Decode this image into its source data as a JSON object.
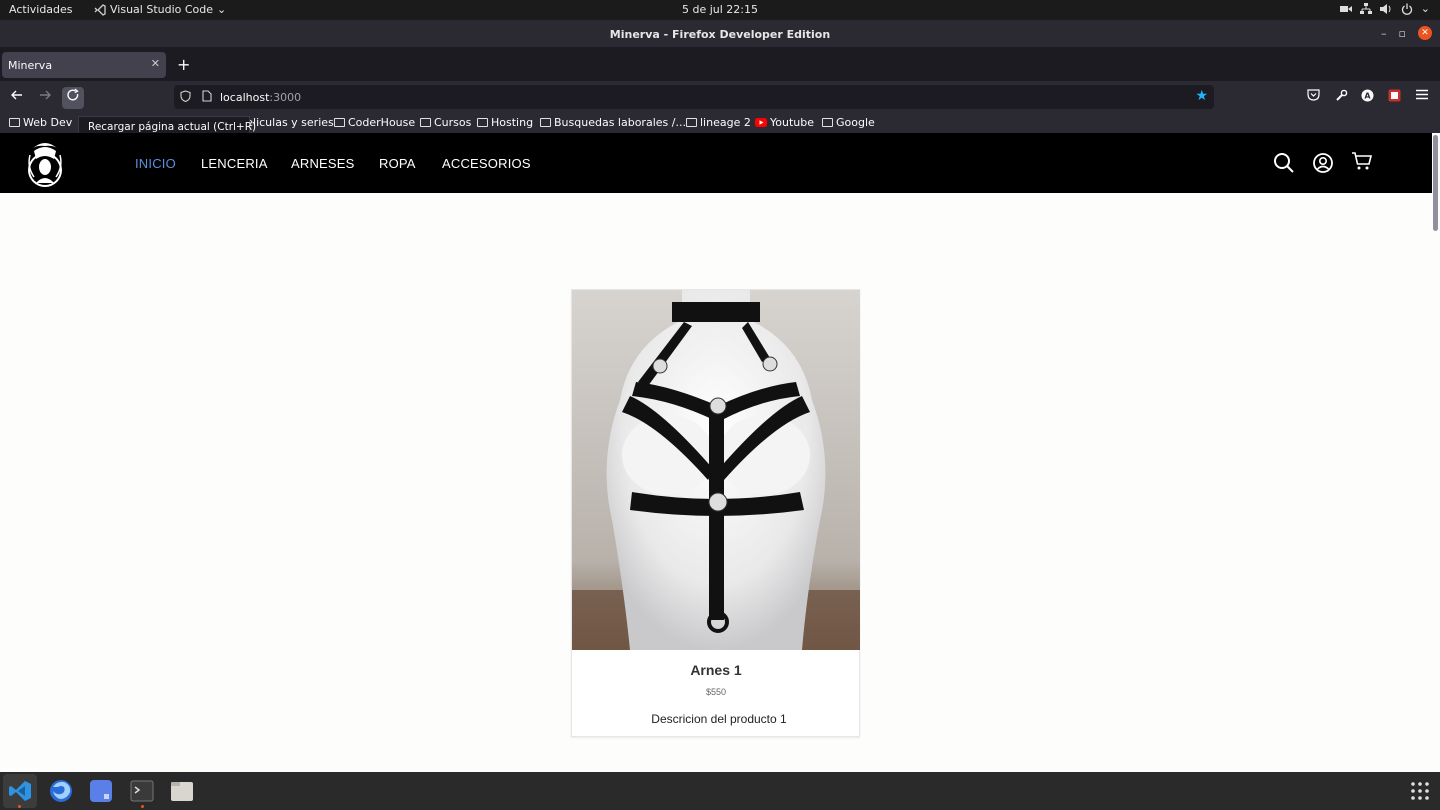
{
  "system": {
    "activities": "Actividades",
    "app_menu": "Visual Studio Code",
    "clock": "5 de jul  22:15"
  },
  "window": {
    "title": "Minerva - Firefox Developer Edition"
  },
  "browser": {
    "tab_label": "Minerva",
    "url_host": "localhost",
    "url_port": ":3000",
    "reload_tooltip": "Recargar página actual (Ctrl+R)",
    "bookmarks": [
      {
        "label": "Web Dev",
        "icon": "folder-icon"
      },
      {
        "label": "Peliculas y series",
        "icon": "folder-icon"
      },
      {
        "label": "CoderHouse",
        "icon": "folder-icon"
      },
      {
        "label": "Cursos",
        "icon": "folder-icon"
      },
      {
        "label": "Hosting",
        "icon": "folder-icon"
      },
      {
        "label": "Busquedas laborales /...",
        "icon": "folder-icon"
      },
      {
        "label": "lineage 2",
        "icon": "folder-icon"
      },
      {
        "label": "Youtube",
        "icon": "youtube-icon"
      },
      {
        "label": "Google",
        "icon": "folder-icon"
      }
    ]
  },
  "site": {
    "menu": [
      {
        "label": "INICIO",
        "active": true
      },
      {
        "label": "LENCERIA",
        "active": false
      },
      {
        "label": "ARNESES",
        "active": false
      },
      {
        "label": "ROPA",
        "active": false
      },
      {
        "label": "ACCESORIOS",
        "active": false
      }
    ],
    "product": {
      "title": "Arnes 1",
      "price": "$550",
      "description": "Descricion del producto 1"
    }
  },
  "colors": {
    "active_menu": "#5b8fe0",
    "accent_star": "#1fb5ff",
    "close_button": "#e95420"
  }
}
